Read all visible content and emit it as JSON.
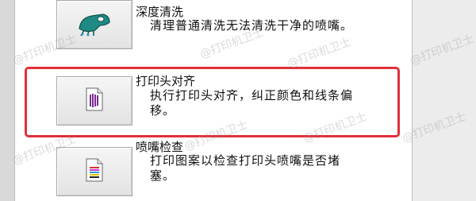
{
  "tools": [
    {
      "title": "深度清洗",
      "description": "清理普通清洗无法清洗干净的喷嘴。",
      "icon": "deep-clean-icon"
    },
    {
      "title": "打印头对齐",
      "description": "执行打印头对齐，纠正颜色和线条偏\n移。",
      "icon": "head-alignment-icon"
    },
    {
      "title": "喷嘴检查",
      "description": "打印图案以检查打印头喷嘴是否堵\n塞。",
      "icon": "nozzle-check-icon"
    }
  ],
  "watermark": "@打印机卫士",
  "colors": {
    "highlight": "#e0303a",
    "icon_teal": "#1f8a84",
    "icon_purple": "#7a2a8f"
  }
}
